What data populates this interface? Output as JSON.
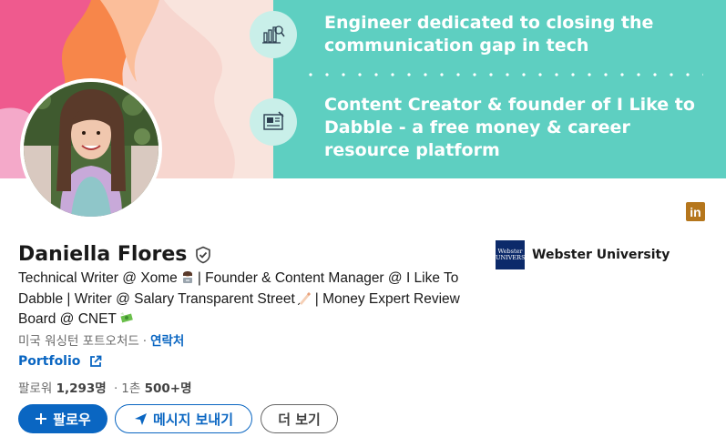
{
  "banner": {
    "line1": "Engineer dedicated to closing the",
    "line2": "communication gap in tech",
    "line3": "Content Creator & founder of I Like to",
    "line4": "Dabble - a free money & career",
    "line5": "resource platform"
  },
  "profile": {
    "name": "Daniella Flores",
    "headline_part1": "Technical Writer @ Xome",
    "headline_part2": "| Founder & Content Manager @ I Like To Dabble | Writer @ Salary Transparent Street",
    "headline_part3": "| Money Expert Review Board @ CNET",
    "location": "미국 워싱턴 포트오처드",
    "location_sep": "·",
    "contact_label": "연락처",
    "portfolio_label": "Portfolio",
    "followers_label": "팔로워",
    "followers_count": "1,293명",
    "connections_sep": "·",
    "connections_degree": "1촌",
    "connections_count": "500+명"
  },
  "actions": {
    "follow_label": "팔로우",
    "message_label": "메시지 보내기",
    "more_label": "더 보기"
  },
  "education": {
    "school_name": "Webster University",
    "logo_text": "Webster UNIVERSITY"
  },
  "badge": {
    "linkedin_text": "in"
  },
  "colors": {
    "brand_blue": "#0a66c2",
    "banner_teal": "#5ecfc1",
    "banner_pink": "#f7d6cf",
    "banner_orange": "#f7864a",
    "linkedin_badge": "#b5761c"
  }
}
